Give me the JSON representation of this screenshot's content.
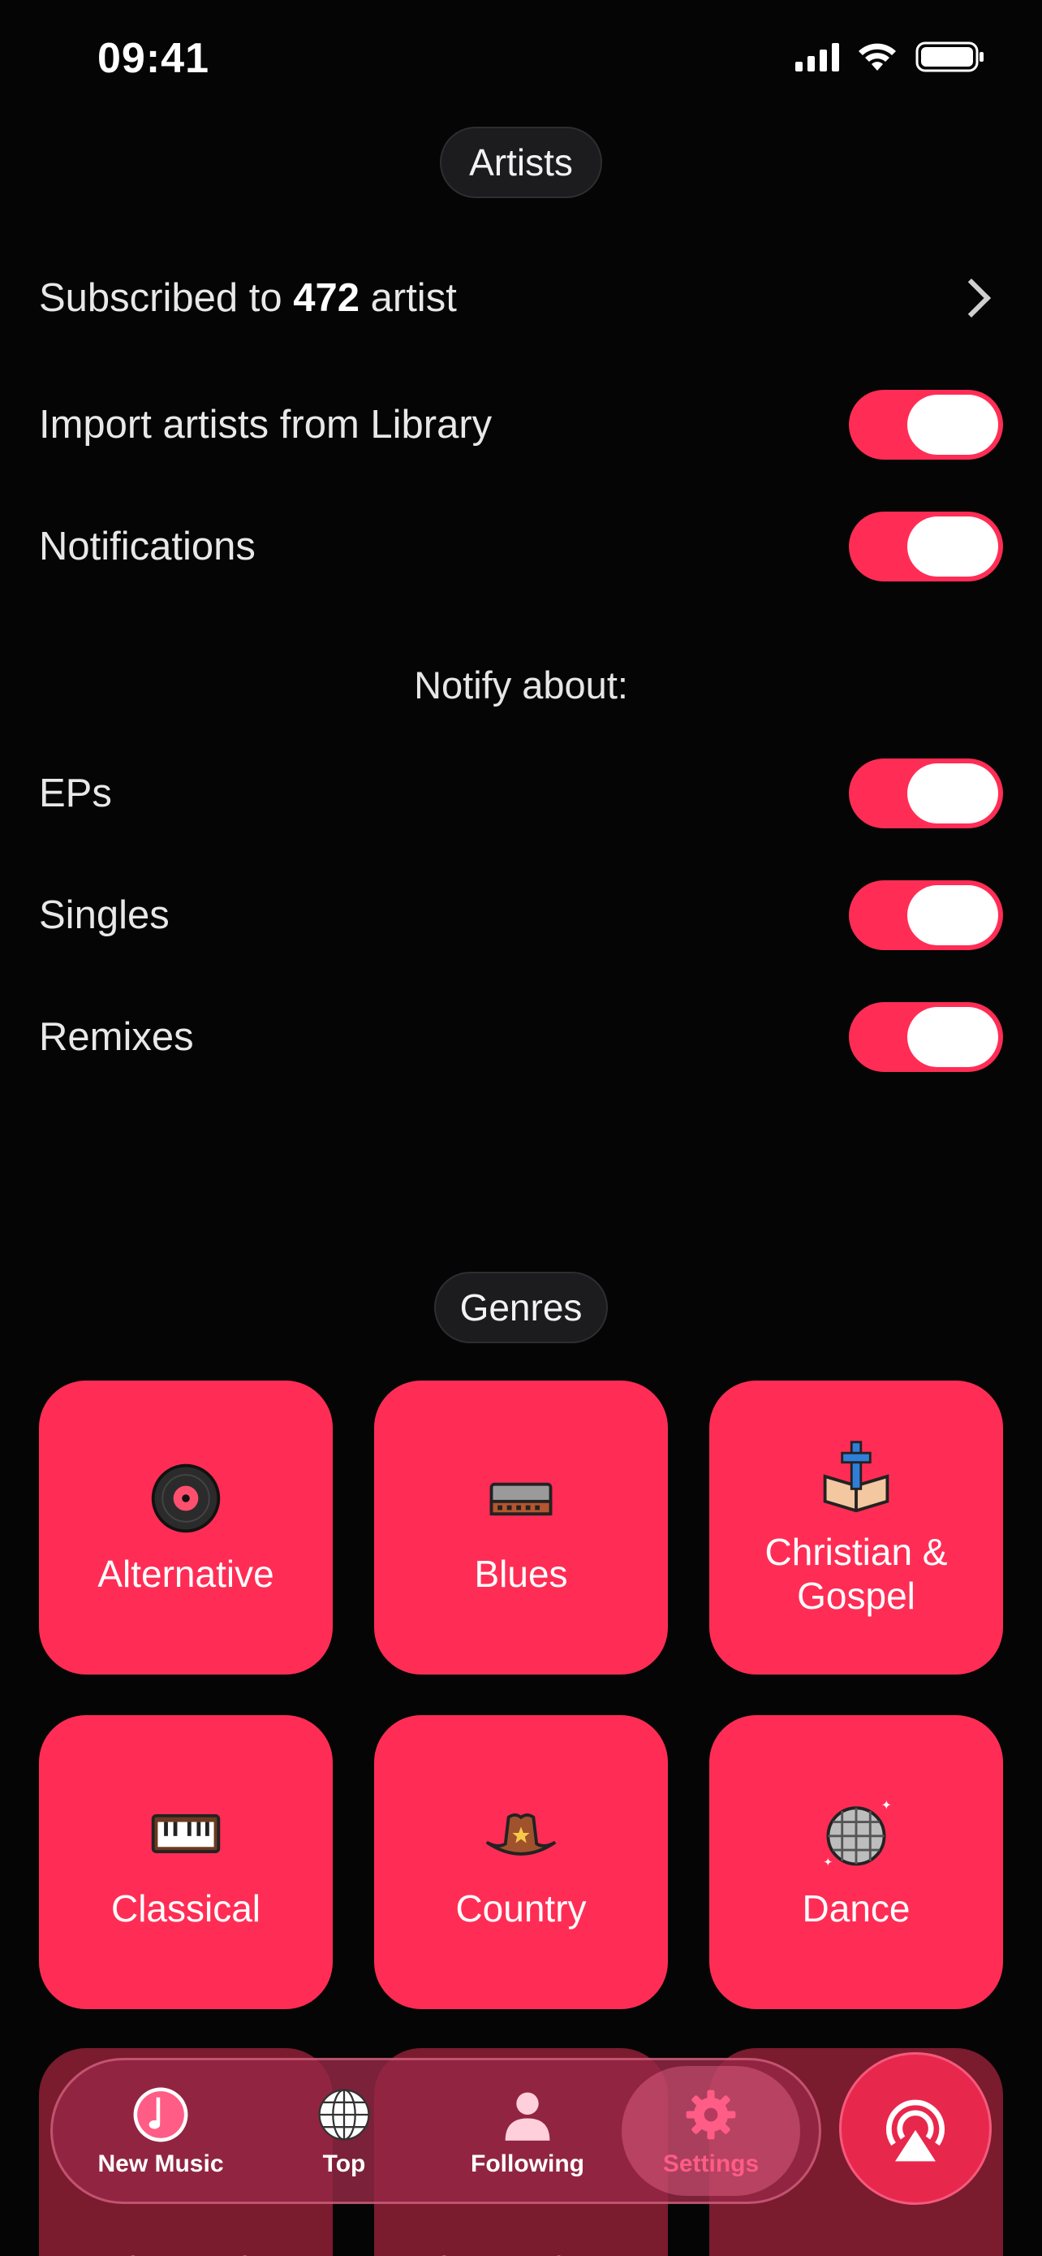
{
  "status_bar": {
    "time": "09:41"
  },
  "artists_section": {
    "title": "Artists",
    "subscribed_prefix": "Subscribed to ",
    "subscribed_count": "472",
    "subscribed_suffix": " artist",
    "import_label": "Import artists from Library",
    "import_on": true,
    "notifications_label": "Notifications",
    "notifications_on": true,
    "notify_heading": "Notify about:",
    "notify_items": [
      {
        "label": "EPs",
        "on": true
      },
      {
        "label": "Singles",
        "on": true
      },
      {
        "label": "Remixes",
        "on": true
      }
    ]
  },
  "genres_section": {
    "title": "Genres",
    "tiles": [
      {
        "label": "Alternative",
        "icon": "vinyl-record-icon"
      },
      {
        "label": "Blues",
        "icon": "harmonica-icon"
      },
      {
        "label": "Christian & Gospel",
        "icon": "bible-cross-icon"
      },
      {
        "label": "Classical",
        "icon": "piano-keyboard-icon"
      },
      {
        "label": "Country",
        "icon": "cowboy-hat-icon"
      },
      {
        "label": "Dance",
        "icon": "disco-ball-icon"
      }
    ],
    "partial_tiles": [
      "Electronic",
      "Hip-Hop/Rap",
      "Jazz"
    ]
  },
  "tab_bar": {
    "tabs": [
      {
        "label": "New Music",
        "icon": "music-note-icon"
      },
      {
        "label": "Top",
        "icon": "globe-icon"
      },
      {
        "label": "Following",
        "icon": "person-icon"
      },
      {
        "label": "Settings",
        "icon": "gear-icon",
        "active": true
      }
    ],
    "cast_icon": "airplay-icon"
  },
  "colors": {
    "accent": "#ff2d55",
    "background": "#050505"
  }
}
